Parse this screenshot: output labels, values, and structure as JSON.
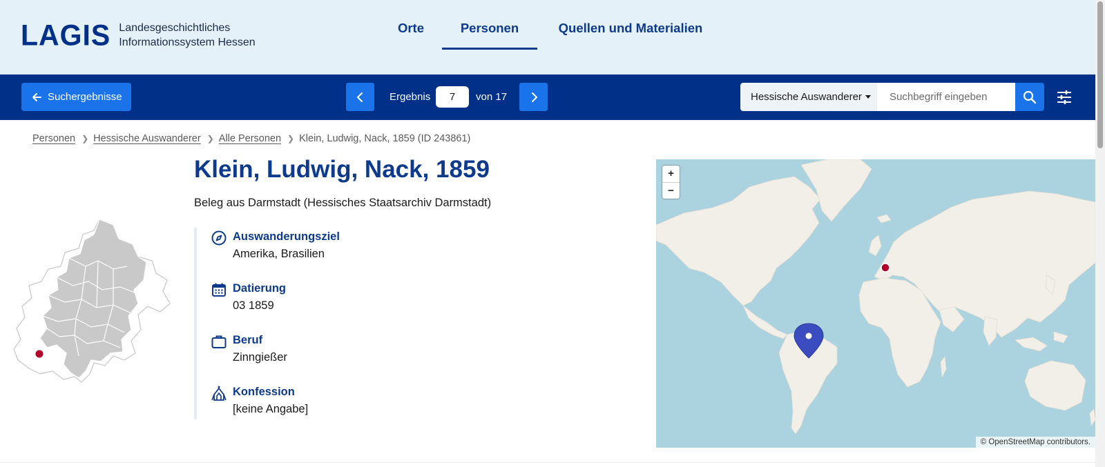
{
  "header": {
    "logo": "LAGIS",
    "subtitle_line1": "Landesgeschichtliches",
    "subtitle_line2": "Informationssystem Hessen",
    "nav": [
      {
        "label": "Orte",
        "active": false
      },
      {
        "label": "Personen",
        "active": true
      },
      {
        "label": "Quellen und Materialien",
        "active": false
      }
    ]
  },
  "toolbar": {
    "back_label": "Suchergebnisse",
    "result_label": "Ergebnis",
    "current_result": "7",
    "total_label": "von 17",
    "search_scope": "Hessische Auswanderer",
    "search_placeholder": "Suchbegriff eingeben"
  },
  "breadcrumb": {
    "items": [
      "Personen",
      "Hessische Auswanderer",
      "Alle Personen"
    ],
    "current": "Klein, Ludwig, Nack, 1859 (ID 243861)"
  },
  "record": {
    "title": "Klein, Ludwig, Nack, 1859",
    "source": "Beleg aus Darmstadt (Hessisches Staatsarchiv Darmstadt)",
    "facts": [
      {
        "label": "Auswanderungsziel",
        "value": "Amerika, Brasilien",
        "icon": "compass-icon"
      },
      {
        "label": "Datierung",
        "value": "03 1859",
        "icon": "calendar-icon"
      },
      {
        "label": "Beruf",
        "value": "Zinngießer",
        "icon": "briefcase-icon"
      },
      {
        "label": "Konfession",
        "value": "[keine Angabe]",
        "icon": "church-icon"
      }
    ]
  },
  "map": {
    "zoom_in": "+",
    "zoom_out": "−",
    "attribution_prefix": "© ",
    "attribution_link": "OpenStreetMap",
    "attribution_suffix": " contributors."
  },
  "colors": {
    "brand": "#003087",
    "accent": "#1a73e8",
    "header_bg": "#e5f1f8",
    "origin_marker": "#b0002a",
    "destination_marker": "#3b4cc0",
    "water": "#aad3df",
    "land": "#f2efe9"
  }
}
